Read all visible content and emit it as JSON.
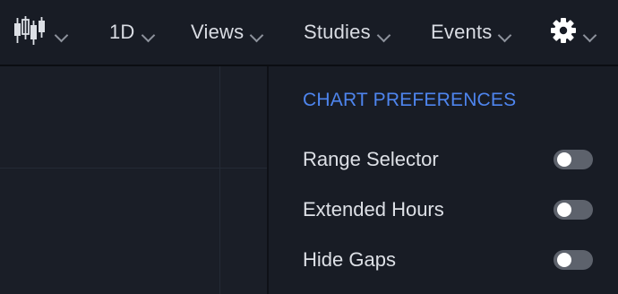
{
  "toolbar": {
    "chart_type_icon": "candlestick-icon",
    "interval_label": "1D",
    "views_label": "Views",
    "studies_label": "Studies",
    "events_label": "Events",
    "settings_icon": "gear-icon"
  },
  "preferences": {
    "title": "CHART PREFERENCES",
    "items": [
      {
        "label": "Range Selector",
        "enabled": false
      },
      {
        "label": "Extended Hours",
        "enabled": false
      },
      {
        "label": "Hide Gaps",
        "enabled": false
      }
    ]
  },
  "colors": {
    "accent": "#4e85ee",
    "background": "#1a1e27",
    "toggle_off": "#5d626c"
  }
}
